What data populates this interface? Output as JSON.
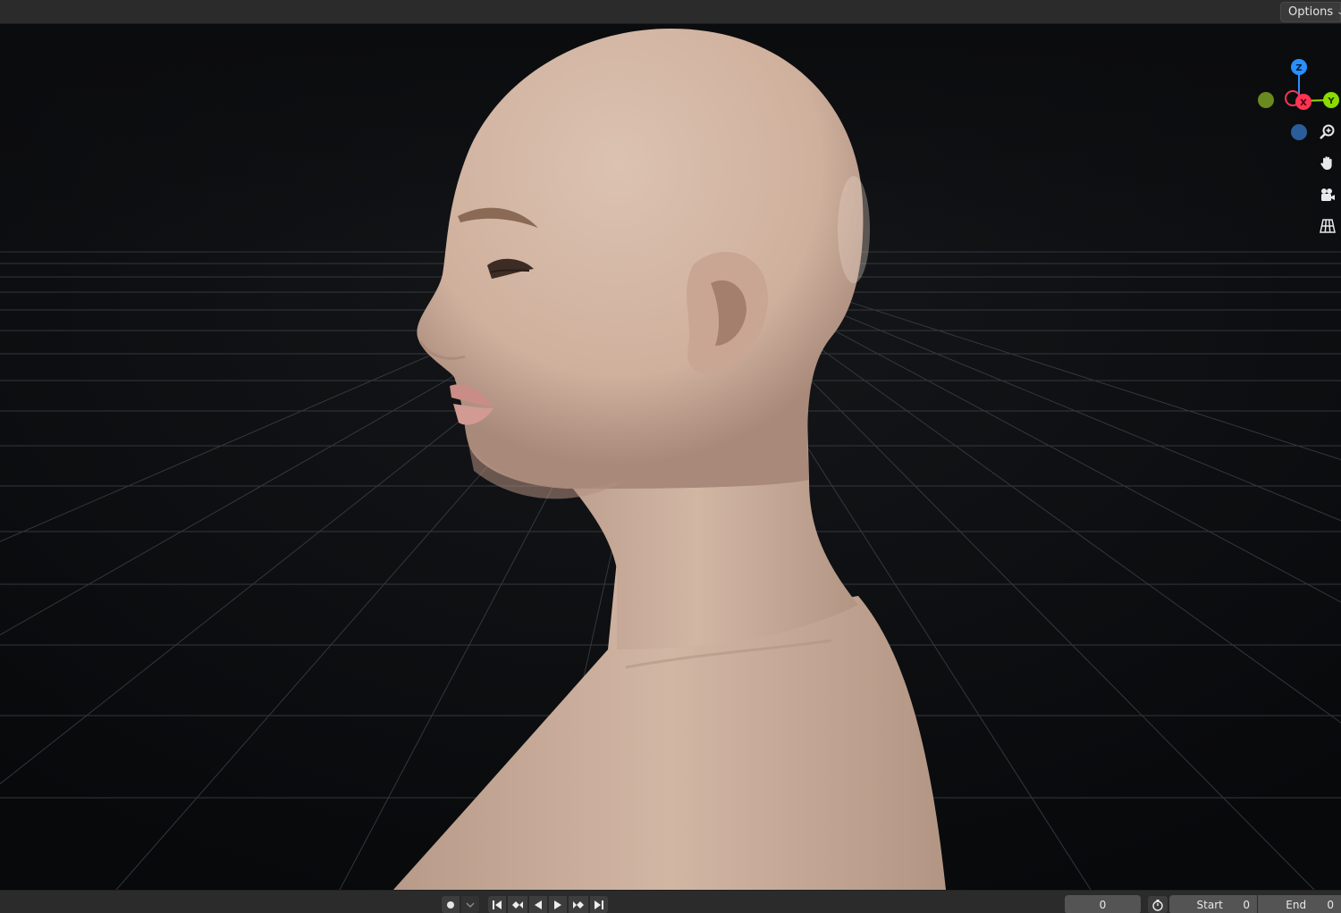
{
  "header": {
    "options_label": "Options"
  },
  "gizmo": {
    "axes": {
      "z": "Z",
      "x": "X",
      "y": "Y"
    },
    "colors": {
      "x": "#ff3352",
      "y": "#8bdc00",
      "z": "#2890ff"
    }
  },
  "nav_tools": [
    {
      "icon": "zoom-icon"
    },
    {
      "icon": "hand-pan-icon"
    },
    {
      "icon": "camera-view-icon"
    },
    {
      "icon": "perspective-grid-icon"
    }
  ],
  "timeline": {
    "current_frame": "0",
    "start_label": "Start",
    "start_value": "0",
    "end_label": "End",
    "end_value": "0"
  }
}
